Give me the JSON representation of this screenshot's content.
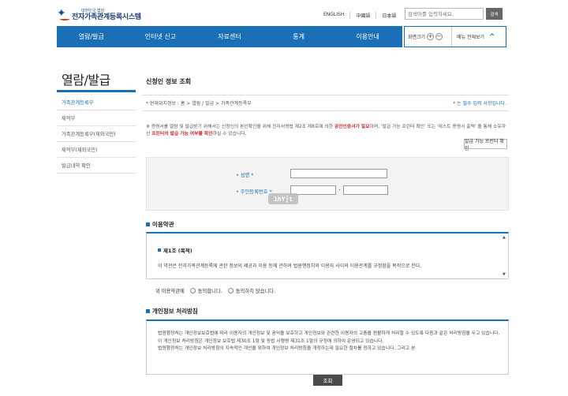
{
  "header": {
    "logo_sub": "대한민국 법원",
    "logo_main": "전자가족관계등록시스템",
    "languages": [
      "ENGLISH",
      "中國語",
      "日本語"
    ],
    "search_placeholder": "검색어를 입력하세요.",
    "search_button": "검색"
  },
  "nav": {
    "items": [
      "열람/발급",
      "인터넷 신고",
      "자료센터",
      "통계",
      "이용안내"
    ],
    "zoom_label": "화면크기",
    "zoom_in": "+",
    "zoom_out": "−",
    "menu_all": "메뉴 전체보기",
    "menu_all_chevron": "^"
  },
  "sidebar": {
    "title": "열람/발급",
    "items": [
      {
        "label": "가족관계등록부",
        "active": true
      },
      {
        "label": "제적부",
        "active": false
      },
      {
        "label": "가족관계등록부(재외국민)",
        "active": false
      },
      {
        "label": "제적부(재외국민)",
        "active": false
      },
      {
        "label": "발급내역 확인",
        "active": false
      }
    ]
  },
  "main": {
    "page_title": "신청인 정보 조회",
    "breadcrumb": "* 현재위치정보 : 홈 > 열람 / 발급 > 가족관계등록부",
    "required_note": "* 는 필수 입력 사항입니다.",
    "notice_part1": "※ 증명서를 열람 및 발급받기 위해서는 신청인의 본인확인을 위해 전자서명법 제2조 제8호에 의한 ",
    "notice_red1": "공인인증서가 필요",
    "notice_part2": "하며, '발급 가능 프린터 확인' 또는 '테스트 증명서 출력' 을 통해 소유하신 ",
    "notice_red2": "프린터의 발급 가능 여부를 확인",
    "notice_part3": "하실 수 있습니다.",
    "printer_button": "발급 가능 프린터 확인",
    "form": {
      "name_label": "• 성명 *",
      "ssn_label": "• 주민등록번호 *",
      "ssn_dash": "-",
      "ssn_badge": "1hYjt"
    },
    "terms": {
      "title": "이용약관",
      "article_title": "제1조 (목적)",
      "article_text": "이 약관은 전자가족관계등록에 관한 정보의 제공과 이용 등에 관하여 법원행정처와 이용자 사이의 이용관계를 규정함을 목적으로 한다.",
      "scroll_up": "▲",
      "scroll_down": "▼",
      "agree_prefix": "위 이용약관에",
      "agree_yes": "동의합니다.",
      "agree_no": "동의하지 않습니다."
    },
    "privacy": {
      "title": "개인정보 처리방침",
      "lines": [
        "법원행정처는 개인정보보호법에 따라 이용자의 개인정보 및 권익을 보호하고 개인정보와 관련한 이용자의 고충을 원활하게 처리할 수 있도록 다음과 같은 처리방침을 두고 있습니다.",
        "이 개인정보 처리방침은 개인정보 보호법 제30조 1항 및 동법 시행령 제31조 1항의 규정에 의하여 운영되고 있습니다.",
        "법원행정처는 개인정보 처리방침의 지속적인 개선을 위하여 개인정보 처리방침을 개정하는데 필요한 절차를 정하고 있습니다. 그리고 본"
      ]
    },
    "submit_button": "조회"
  }
}
